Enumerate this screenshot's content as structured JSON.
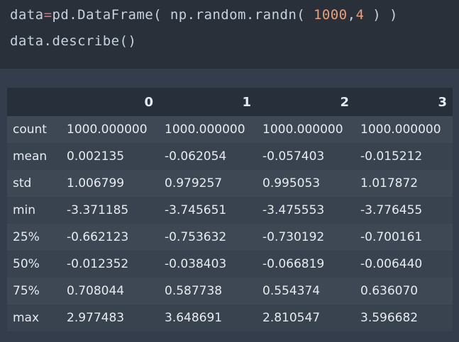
{
  "code": {
    "line1": {
      "a": "data",
      "eq": "=",
      "b": "pd.DataFrame( np.random.randn( ",
      "n1": "1000",
      "comma": ",",
      "n2": "4",
      "c": " ) )"
    },
    "line2": "data.describe()"
  },
  "table": {
    "columns": [
      "0",
      "1",
      "2",
      "3"
    ],
    "rows": [
      {
        "label": "count",
        "values": [
          "1000.000000",
          "1000.000000",
          "1000.000000",
          "1000.000000"
        ]
      },
      {
        "label": "mean",
        "values": [
          "0.002135",
          "-0.062054",
          "-0.057403",
          "-0.015212"
        ]
      },
      {
        "label": "std",
        "values": [
          "1.006799",
          "0.979257",
          "0.995053",
          "1.017872"
        ]
      },
      {
        "label": "min",
        "values": [
          "-3.371185",
          "-3.745651",
          "-3.475553",
          "-3.776455"
        ]
      },
      {
        "label": "25%",
        "values": [
          "-0.662123",
          "-0.753632",
          "-0.730192",
          "-0.700161"
        ]
      },
      {
        "label": "50%",
        "values": [
          "-0.012352",
          "-0.038403",
          "-0.066819",
          "-0.006440"
        ]
      },
      {
        "label": "75%",
        "values": [
          "0.708044",
          "0.587738",
          "0.554374",
          "0.636070"
        ]
      },
      {
        "label": "max",
        "values": [
          "2.977483",
          "3.648691",
          "2.810547",
          "3.596682"
        ]
      }
    ]
  }
}
